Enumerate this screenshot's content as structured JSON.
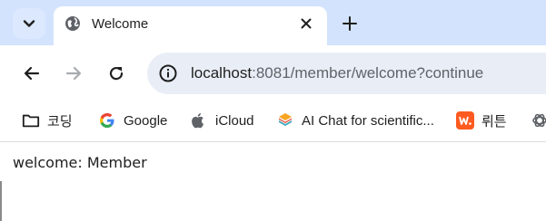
{
  "tab": {
    "title": "Welcome"
  },
  "address_bar": {
    "host": "localhost",
    "rest": ":8081/member/welcome?continue"
  },
  "bookmarks": [
    {
      "label": "코딩",
      "icon": "folder-icon"
    },
    {
      "label": "Google",
      "icon": "google-icon"
    },
    {
      "label": "iCloud",
      "icon": "apple-icon"
    },
    {
      "label": "AI Chat for scientific...",
      "icon": "ai-chat-icon"
    },
    {
      "label": "뤼튼",
      "icon": "wrtn-icon"
    },
    {
      "label": "",
      "icon": "openai-icon"
    }
  ],
  "page": {
    "welcome_text": "welcome: Member"
  },
  "colors": {
    "tabstrip": "#d3e3fd",
    "omnibox": "#e9eef6",
    "wrtn": "#ff5a1f"
  }
}
